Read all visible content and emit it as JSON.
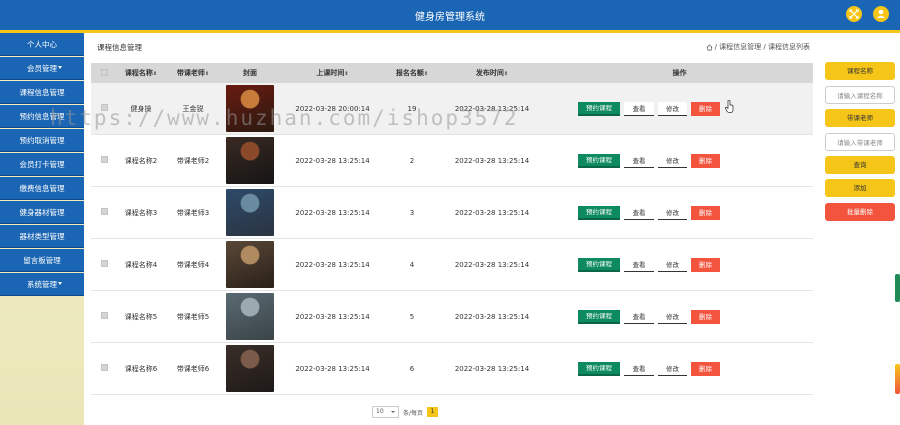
{
  "app": {
    "title": "健身房管理系统"
  },
  "header": {
    "left_icon": "expand-icon",
    "right_icon": "user-icon"
  },
  "sidebar": {
    "items": [
      {
        "label": "个人中心",
        "caret": false
      },
      {
        "label": "会员管理",
        "caret": true
      },
      {
        "label": "课程信息管理",
        "caret": false
      },
      {
        "label": "预约信息管理",
        "caret": false
      },
      {
        "label": "预约取消管理",
        "caret": false
      },
      {
        "label": "会员打卡管理",
        "caret": false
      },
      {
        "label": "缴费信息管理",
        "caret": false
      },
      {
        "label": "健身器材管理",
        "caret": false
      },
      {
        "label": "器材类型管理",
        "caret": false
      },
      {
        "label": "留言板管理",
        "caret": false
      },
      {
        "label": "系统管理",
        "caret": true
      }
    ]
  },
  "page": {
    "title": "课程信息管理",
    "breadcrumb": "/ 课程信息管理 / 课程信息列表"
  },
  "table": {
    "headers": {
      "name": "课程名称",
      "teacher": "带课老师",
      "cover": "封面",
      "time": "上课时间",
      "count": "报名名额",
      "publish": "发布时间",
      "ops": "操作"
    },
    "rows": [
      {
        "name": "健身操",
        "teacher": "王金锐",
        "time": "2022-03-28 20:00:14",
        "count": "19",
        "publish": "2022-03-28 13:25:14"
      },
      {
        "name": "课程名称2",
        "teacher": "带课老师2",
        "time": "2022-03-28 13:25:14",
        "count": "2",
        "publish": "2022-03-28 13:25:14"
      },
      {
        "name": "课程名称3",
        "teacher": "带课老师3",
        "time": "2022-03-28 13:25:14",
        "count": "3",
        "publish": "2022-03-28 13:25:14"
      },
      {
        "name": "课程名称4",
        "teacher": "带课老师4",
        "time": "2022-03-28 13:25:14",
        "count": "4",
        "publish": "2022-03-28 13:25:14"
      },
      {
        "name": "课程名称5",
        "teacher": "带课老师5",
        "time": "2022-03-28 13:25:14",
        "count": "5",
        "publish": "2022-03-28 13:25:14"
      },
      {
        "name": "课程名称6",
        "teacher": "带课老师6",
        "time": "2022-03-28 13:25:14",
        "count": "6",
        "publish": "2022-03-28 13:25:14"
      }
    ],
    "buttons": {
      "book": "预约课程",
      "view": "查看",
      "edit": "修改",
      "delete": "删除"
    }
  },
  "pager": {
    "page_size": "10",
    "per_page_label": "条/每页",
    "current_page": "1"
  },
  "search": {
    "name_label": "课程名称",
    "name_placeholder": "请输入课程名称",
    "teacher_label": "带课老师",
    "teacher_placeholder": "请输入带课老师",
    "query": "查询",
    "add": "添加",
    "batch_delete": "批量删除"
  },
  "watermark": "https://www.huzhan.com/ishop3572",
  "colors": {
    "primary": "#1b66b4",
    "accent": "#f5c518",
    "success": "#0e8a60",
    "danger": "#f2543e"
  }
}
